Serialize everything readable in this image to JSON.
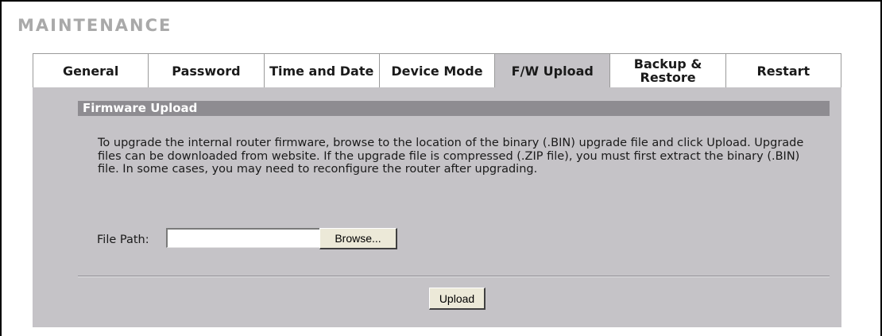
{
  "page": {
    "title": "MAINTENANCE"
  },
  "tabs": [
    {
      "label": "General",
      "active": false
    },
    {
      "label": "Password",
      "active": false
    },
    {
      "label": "Time and Date",
      "active": false
    },
    {
      "label": "Device Mode",
      "active": false
    },
    {
      "label": "F/W Upload",
      "active": true
    },
    {
      "label": "Backup &\nRestore",
      "active": false
    },
    {
      "label": "Restart",
      "active": false
    }
  ],
  "section": {
    "header": "Firmware Upload",
    "description": "To upgrade the internal router firmware, browse to the location of the binary (.BIN) upgrade file and click Upload. Upgrade files can be downloaded from website. If the upgrade file is compressed (.ZIP file), you must first extract the binary (.BIN) file. In some cases, you may need to reconfigure the router after upgrading."
  },
  "form": {
    "file_path_label": "File Path:",
    "file_path_value": "",
    "browse_label": "Browse...",
    "upload_label": "Upload"
  },
  "colors": {
    "title": "#a9a9a9",
    "panel": "#c5c3c7",
    "section_header": "#8e8c91",
    "active_tab": "#c5c3c7"
  }
}
